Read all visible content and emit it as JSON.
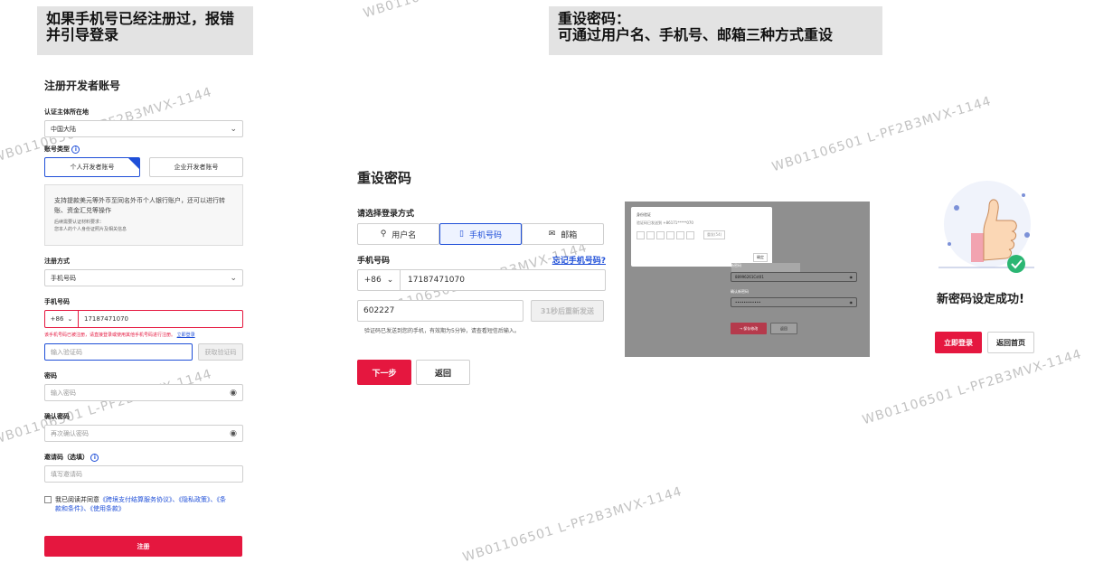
{
  "watermark": "WB01106501 L-PF2B3MVX-1144",
  "notes": {
    "left": "如果手机号已经注册过，报错并引导登录",
    "right_line1": "重设密码：",
    "right_line2": "可通过用户名、手机号、邮箱三种方式重设"
  },
  "register": {
    "title": "注册开发者账号",
    "region_label": "认证主体所在地",
    "region_value": "中国大陆",
    "account_type_label": "账号类型",
    "personal_tab": "个人开发者账号",
    "enterprise_tab": "企业开发者账号",
    "info_line1": "支持提款美元等外币至同名外币个人银行账户，还可以进行转",
    "info_line2": "账、资金汇兑等操作",
    "info_line3": "后续需要认证材料要求：",
    "info_line4": "您本人的个人身份证照片及相关信息",
    "method_label": "注册方式",
    "method_value": "手机号码",
    "phone_label": "手机号码",
    "phone_code": "+86",
    "phone_value": "17187471070",
    "phone_error": "该手机号码已被注册，请直接登录或使用其他手机号码进行注册。",
    "phone_error_link": "立即登录",
    "code_placeholder": "输入验证码",
    "code_button": "获取验证码",
    "password_label": "密码",
    "password_placeholder": "输入密码",
    "confirm_label": "确认密码",
    "confirm_placeholder": "再次确认密码",
    "invite_label": "邀请码（选填）",
    "invite_placeholder": "填写邀请码",
    "agree_prefix": "我已阅读并同意",
    "agree_links_1": "《跨境支付结算服务协议》、《隐私政策》、《条",
    "agree_links_2": "款和条件》、《使用条款》",
    "submit": "注册"
  },
  "reset": {
    "title": "重设密码",
    "choose_label": "请选择登录方式",
    "tab_user": "用户名",
    "tab_phone": "手机号码",
    "tab_email": "邮箱",
    "phone_label": "手机号码",
    "forgot_link": "忘记手机号码?",
    "phone_code": "+86",
    "phone_value": "17187471070",
    "code_value": "602227",
    "resend": "31秒后重新发送",
    "hint": "验证码已发送到您的手机，有效期为5分钟，请查看短信后输入。",
    "next": "下一步",
    "back": "返回"
  },
  "mock": {
    "dialog_title": "身份验证",
    "dialog_sub": "验证码已发送到 +86171*****070",
    "dialog_btn": "重发(54)",
    "dialog_ok": "确定",
    "new_pwd_label": "新密码",
    "new_pwd_value": "88996261Cst01",
    "confirm_label": "确认新密码",
    "confirm_value": "••••••••••••",
    "save_btn": "→ 保存修改",
    "back_btn": "返回"
  },
  "success": {
    "title": "新密码设定成功!",
    "login": "立即登录",
    "home": "返回首页"
  },
  "colors": {
    "accent": "#e5173f",
    "link": "#1f4fd8",
    "selected": "#1f4fd8"
  }
}
